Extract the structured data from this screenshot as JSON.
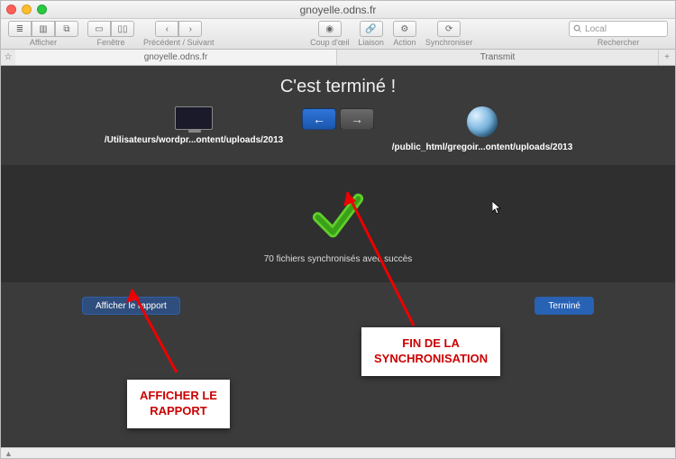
{
  "window_title": "gnoyelle.odns.fr",
  "toolbar": {
    "view_label": "Afficher",
    "window_label": "Fenêtre",
    "nav_label": "Précédent / Suivant",
    "quicklook_label": "Coup d'œil",
    "link_label": "Liaison",
    "action_label": "Action",
    "sync_label": "Synchroniser",
    "search_placeholder": "Local",
    "search_label": "Rechercher"
  },
  "tabs": {
    "host": "gnoyelle.odns.fr",
    "app": "Transmit"
  },
  "main": {
    "heading": "C'est terminé !",
    "local_path": "/Utilisateurs/wordpr...ontent/uploads/2013",
    "remote_path": "/public_html/gregoir...ontent/uploads/2013",
    "status": "70 fichiers synchronisés avec succès",
    "report_btn": "Afficher le rapport",
    "done_btn": "Terminé"
  },
  "annotations": {
    "report": "AFFICHER LE\nRAPPORT",
    "finish": "FIN DE LA\nSYNCHRONISATION"
  }
}
